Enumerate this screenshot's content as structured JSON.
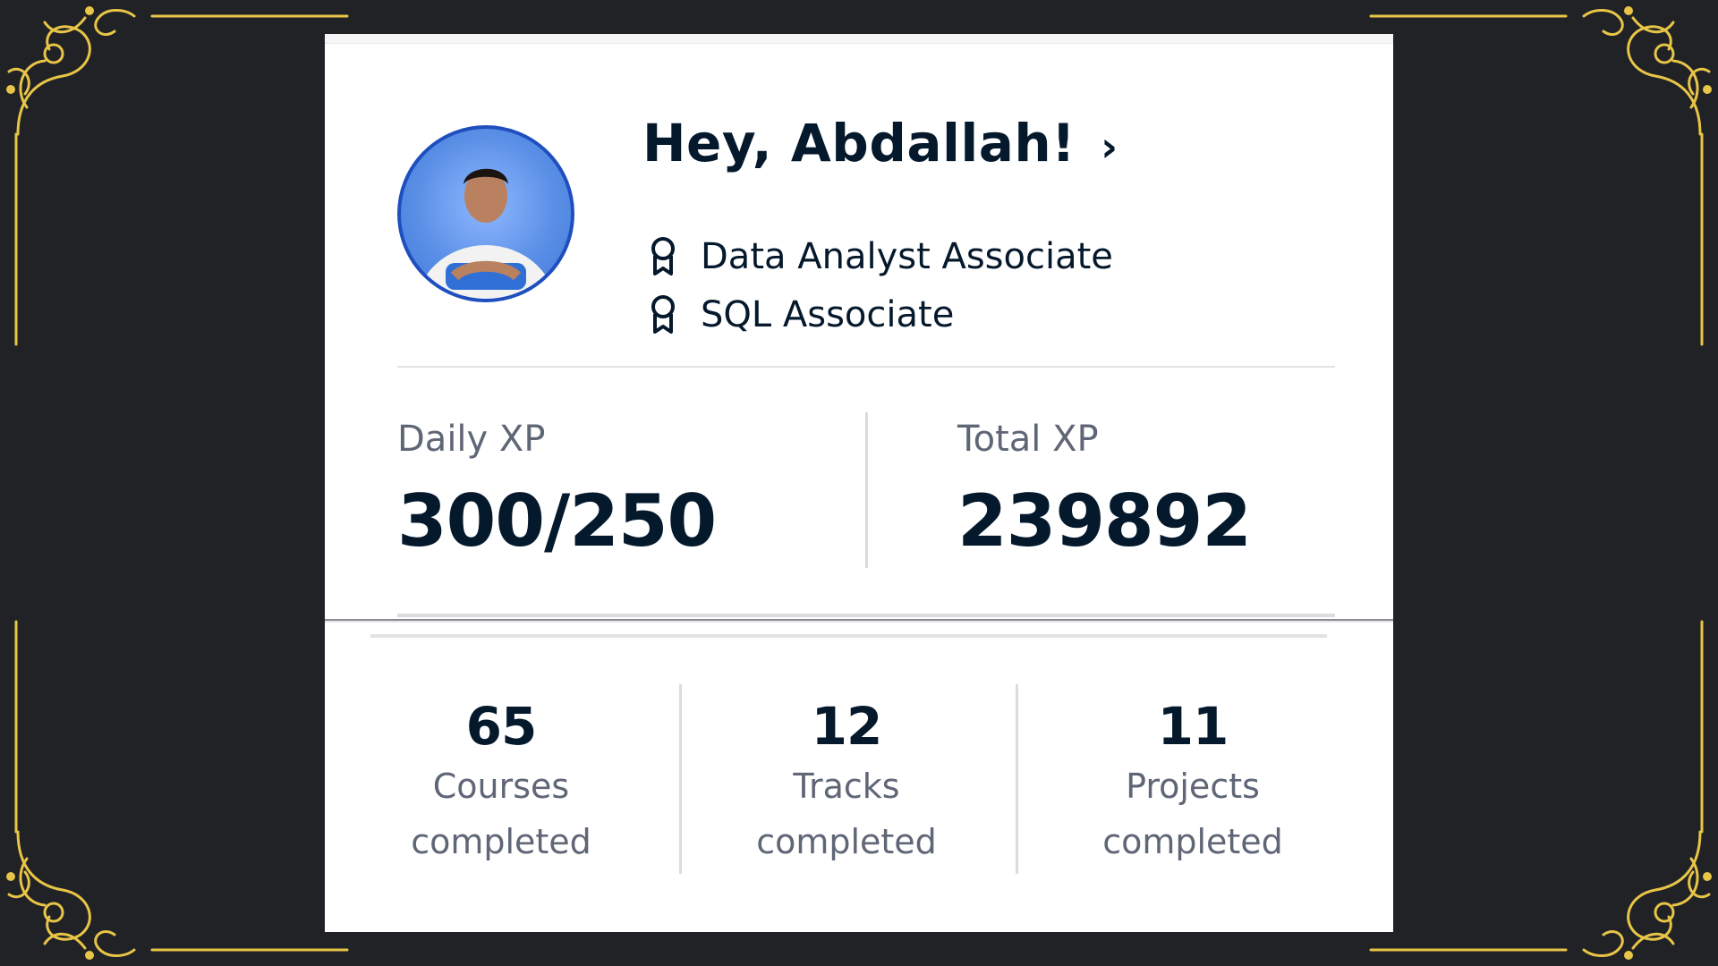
{
  "greeting": {
    "title": "Hey, Abdallah!"
  },
  "certifications": [
    {
      "label": "Data Analyst Associate",
      "icon": "award-ribbon-icon"
    },
    {
      "label": "SQL Associate",
      "icon": "award-ribbon-icon"
    }
  ],
  "xp": {
    "daily_label": "Daily XP",
    "daily_value": "300/250",
    "total_label": "Total XP",
    "total_value": "239892"
  },
  "stats": [
    {
      "value": "65",
      "label_line1": "Courses",
      "label_line2": "completed"
    },
    {
      "value": "12",
      "label_line1": "Tracks",
      "label_line2": "completed"
    },
    {
      "value": "11",
      "label_line1": "Projects",
      "label_line2": "completed"
    }
  ],
  "colors": {
    "background": "#202226",
    "ornament_gold": "#e8c547",
    "card": "#ffffff",
    "text_primary": "#05192d",
    "text_secondary": "#5f6675",
    "avatar_ring": "#1f4fbf"
  }
}
